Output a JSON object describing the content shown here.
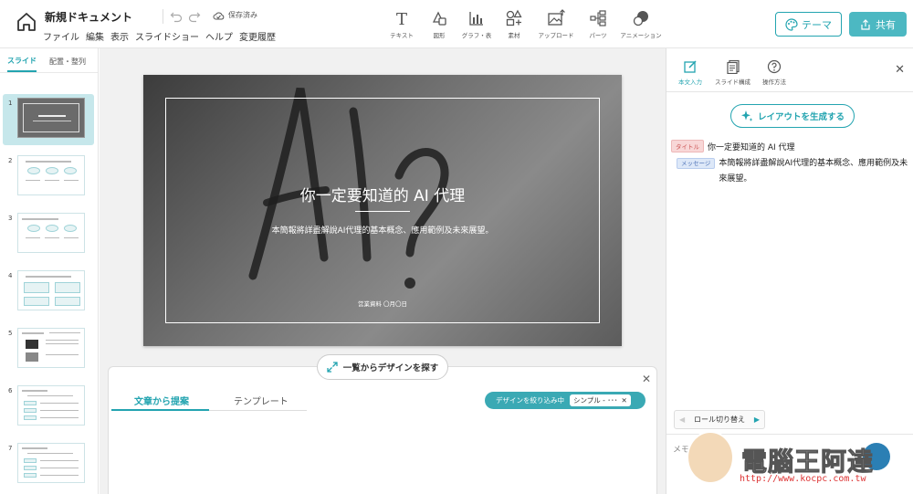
{
  "header": {
    "doc_title": "新規ドキュメント",
    "menu": [
      "ファイル",
      "編集",
      "表示",
      "スライドショー",
      "ヘルプ",
      "変更履歴"
    ],
    "save_status": "保存済み",
    "tools": [
      {
        "label": "テキスト",
        "icon": "text-icon"
      },
      {
        "label": "図形",
        "icon": "shapes-icon"
      },
      {
        "label": "グラフ・表",
        "icon": "chart-icon"
      },
      {
        "label": "素材",
        "icon": "assets-icon"
      },
      {
        "label": "アップロード",
        "icon": "upload-icon"
      },
      {
        "label": "パーツ",
        "icon": "parts-icon"
      },
      {
        "label": "アニメーション",
        "icon": "animation-icon"
      }
    ],
    "theme_label": "テーマ",
    "share_label": "共有",
    "accent": "#23a4b0"
  },
  "left_panel": {
    "tabs": [
      "スライド",
      "配置・整列"
    ],
    "slide_numbers": [
      "1",
      "2",
      "3",
      "4",
      "5",
      "6",
      "7"
    ]
  },
  "slide": {
    "title": "你一定要知道的 AI 代理",
    "subtitle": "本簡報將詳盡解說AI代理的基本概念、應用範例及未來展望。",
    "footer": "営業資料 〇月〇日"
  },
  "canvas": {
    "explore_label": "一覧からデザインを探す"
  },
  "bottom_panel": {
    "tabs": [
      "文章から提案",
      "テンプレート"
    ],
    "filter_label": "デザインを絞り込み中",
    "filter_chip": "シンプル - ･･･"
  },
  "right_panel": {
    "tabs": [
      {
        "label": "本文入力",
        "icon": "edit-icon"
      },
      {
        "label": "スライド構成",
        "icon": "slides-icon"
      },
      {
        "label": "操作方法",
        "icon": "help-icon"
      }
    ],
    "generate_label": "レイアウトを生成する",
    "title_tag": "タイトル",
    "title_text": "你一定要知道的 AI 代理",
    "message_tag": "メッセージ",
    "message_text": "本簡報將詳盡解說AI代理的基本概念、應用範例及未來展望。",
    "role_label": "ロール切り替え",
    "memo_placeholder": "メモ"
  },
  "watermark": {
    "logo": "電腦王阿達",
    "url": "http://www.kocpc.com.tw"
  }
}
